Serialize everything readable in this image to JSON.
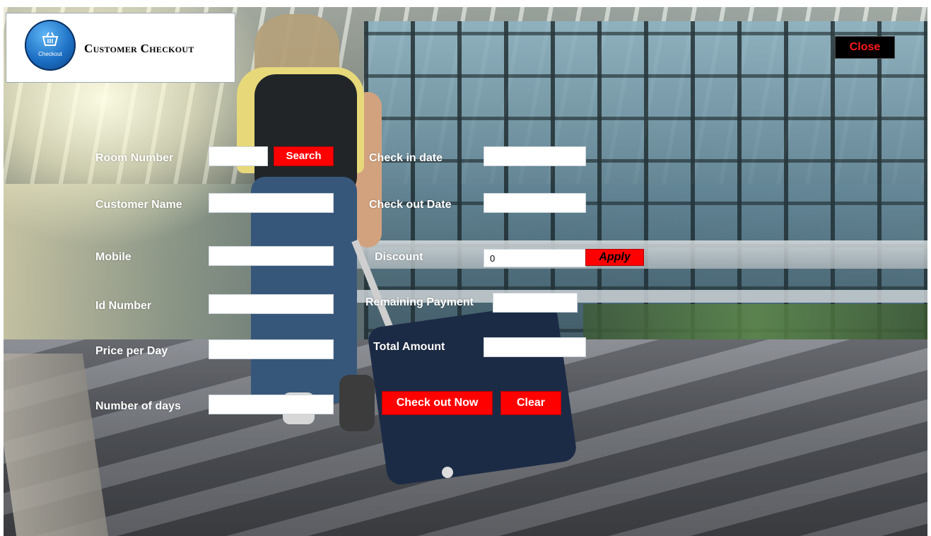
{
  "window": {
    "title": "Customer Checkout",
    "logo_text": "Checkout",
    "close_label": "Close"
  },
  "form": {
    "room_number": {
      "label": "Room Number",
      "value": ""
    },
    "search_label": "Search",
    "customer_name": {
      "label": "Customer Name",
      "value": ""
    },
    "mobile": {
      "label": "Mobile",
      "value": ""
    },
    "id_number": {
      "label": "Id Number",
      "value": ""
    },
    "price_per_day": {
      "label": "Price per Day",
      "value": ""
    },
    "number_of_days": {
      "label": "Number of days",
      "value": ""
    },
    "check_in_date": {
      "label": "Check in date",
      "value": ""
    },
    "check_out_date": {
      "label": "Check out Date",
      "value": ""
    },
    "discount": {
      "label": "Discount",
      "value": "0"
    },
    "apply_label": "Apply",
    "remaining_payment": {
      "label": "Remaining Payment",
      "value": ""
    },
    "total_amount": {
      "label": "Total Amount",
      "value": ""
    },
    "checkout_now_label": "Check out Now",
    "clear_label": "Clear"
  },
  "colors": {
    "accent_red": "#ff0000",
    "close_text": "#ff1a1a",
    "label_text": "#ffffff"
  },
  "icons": {
    "logo": "shopping-basket-icon"
  }
}
